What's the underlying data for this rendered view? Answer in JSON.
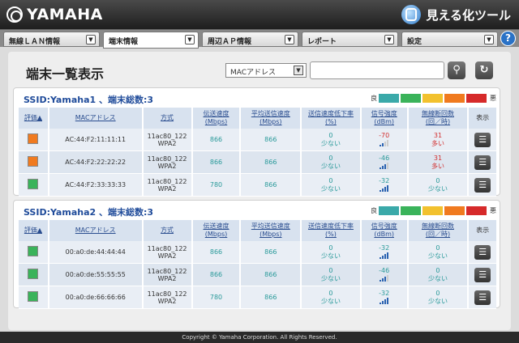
{
  "header": {
    "logo": "YAMAHA",
    "product": "見える化ツール"
  },
  "nav": {
    "tabs": [
      {
        "label": "無線ＬＡＮ情報"
      },
      {
        "label": "端末情報"
      },
      {
        "label": "周辺ＡＰ情報"
      },
      {
        "label": "レポート"
      },
      {
        "label": "設定"
      }
    ],
    "help": "?"
  },
  "page": {
    "title": "端末一覧表示"
  },
  "search": {
    "field_label": "MACアドレス",
    "dropdown": "▼",
    "search_icon": "search-icon",
    "refresh_icon": "refresh-icon"
  },
  "legend": {
    "good": "良",
    "bad": "悪",
    "colors": [
      "#3aa9a9",
      "#3ab35a",
      "#f2c12e",
      "#f07a1f",
      "#d62a2a"
    ]
  },
  "columns": {
    "eval": "評価▲",
    "mac": "MACアドレス",
    "mode": "方式",
    "rate": [
      "伝送速度",
      "(Mbps)"
    ],
    "avg": [
      "平均送信速度",
      "(Mbps)"
    ],
    "drop": [
      "送信速度低下率",
      "(%)"
    ],
    "signal": [
      "信号強度",
      "(dBm)"
    ],
    "disc": [
      "無線断回数",
      "(回／時)"
    ],
    "show": "表示"
  },
  "ssids": [
    {
      "title": "SSID:Yamaha1 、端末総数:3",
      "rows": [
        {
          "color": "#f07a1f",
          "mac": "AC:44:F2:11:11:11",
          "mode1": "11ac80_122",
          "mode2": "WPA2",
          "rate": "866",
          "avg": "866",
          "drop1": "0",
          "drop2": "少ない",
          "signal": "-70",
          "signal_level": 2,
          "disc1": "31",
          "disc2": "多い",
          "bad": true
        },
        {
          "color": "#f07a1f",
          "mac": "AC:44:F2:22:22:22",
          "mode1": "11ac80_122",
          "mode2": "WPA2",
          "rate": "866",
          "avg": "866",
          "drop1": "0",
          "drop2": "少ない",
          "signal": "-46",
          "signal_level": 3,
          "disc1": "31",
          "disc2": "多い",
          "bad": true
        },
        {
          "color": "#3ab35a",
          "mac": "AC:44:F2:33:33:33",
          "mode1": "11ac80_122",
          "mode2": "WPA2",
          "rate": "780",
          "avg": "866",
          "drop1": "0",
          "drop2": "少ない",
          "signal": "-32",
          "signal_level": 4,
          "disc1": "0",
          "disc2": "少ない",
          "bad": false
        }
      ]
    },
    {
      "title": "SSID:Yamaha2 、端末総数:3",
      "rows": [
        {
          "color": "#3ab35a",
          "mac": "00:a0:de:44:44:44",
          "mode1": "11ac80_122",
          "mode2": "WPA2",
          "rate": "866",
          "avg": "866",
          "drop1": "0",
          "drop2": "少ない",
          "signal": "-32",
          "signal_level": 4,
          "disc1": "0",
          "disc2": "少ない",
          "bad": false
        },
        {
          "color": "#3ab35a",
          "mac": "00:a0:de:55:55:55",
          "mode1": "11ac80_122",
          "mode2": "WPA2",
          "rate": "866",
          "avg": "866",
          "drop1": "0",
          "drop2": "少ない",
          "signal": "-46",
          "signal_level": 3,
          "disc1": "0",
          "disc2": "少ない",
          "bad": false
        },
        {
          "color": "#3ab35a",
          "mac": "00:a0:de:66:66:66",
          "mode1": "11ac80_122",
          "mode2": "WPA2",
          "rate": "780",
          "avg": "866",
          "drop1": "0",
          "drop2": "少ない",
          "signal": "-32",
          "signal_level": 4,
          "disc1": "0",
          "disc2": "少ない",
          "bad": false
        }
      ]
    }
  ],
  "footer": "Copyright © Yamaha Corporation. All Rights Reserved."
}
